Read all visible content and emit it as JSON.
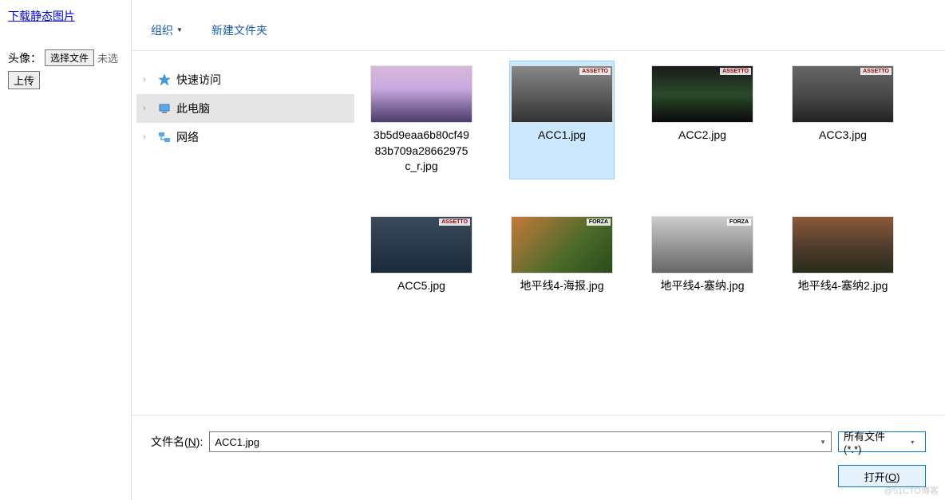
{
  "leftPanel": {
    "downloadLink": "下载静态图片",
    "avatarLabel": "头像：",
    "chooseFileBtn": "选择文件",
    "noFileText": "未选",
    "uploadBtn": "上传"
  },
  "toolbar": {
    "organize": "组织",
    "newFolder": "新建文件夹"
  },
  "sideNav": {
    "quickAccess": "快速访问",
    "thisPC": "此电脑",
    "network": "网络"
  },
  "files": [
    {
      "name": "3b5d9eaa6b80cf4983b709a28662975c_r.jpg",
      "thumbClass": "mountain",
      "selected": false,
      "logo": ""
    },
    {
      "name": "ACC1.jpg",
      "thumbClass": "acc1",
      "selected": true,
      "logo": "red"
    },
    {
      "name": "ACC2.jpg",
      "thumbClass": "acc2",
      "selected": false,
      "logo": "red"
    },
    {
      "name": "ACC3.jpg",
      "thumbClass": "acc3",
      "selected": false,
      "logo": "red"
    },
    {
      "name": "ACC5.jpg",
      "thumbClass": "acc5",
      "selected": false,
      "logo": "red"
    },
    {
      "name": "地平线4-海报.jpg",
      "thumbClass": "poster",
      "selected": false,
      "logo": "white"
    },
    {
      "name": "地平线4-塞纳.jpg",
      "thumbClass": "senna",
      "selected": false,
      "logo": "white"
    },
    {
      "name": "地平线4-塞纳2.jpg",
      "thumbClass": "senna2",
      "selected": false,
      "logo": ""
    }
  ],
  "footer": {
    "filenameLabel": "文件名(",
    "filenameHotkey": "N",
    "filenameLabelEnd": "):",
    "filenameValue": "ACC1.jpg",
    "filterText": "所有文件 (*.*)",
    "openBtn": "打开(",
    "openHotkey": "O",
    "openBtnEnd": ")"
  },
  "watermark": "@51CTO博客"
}
